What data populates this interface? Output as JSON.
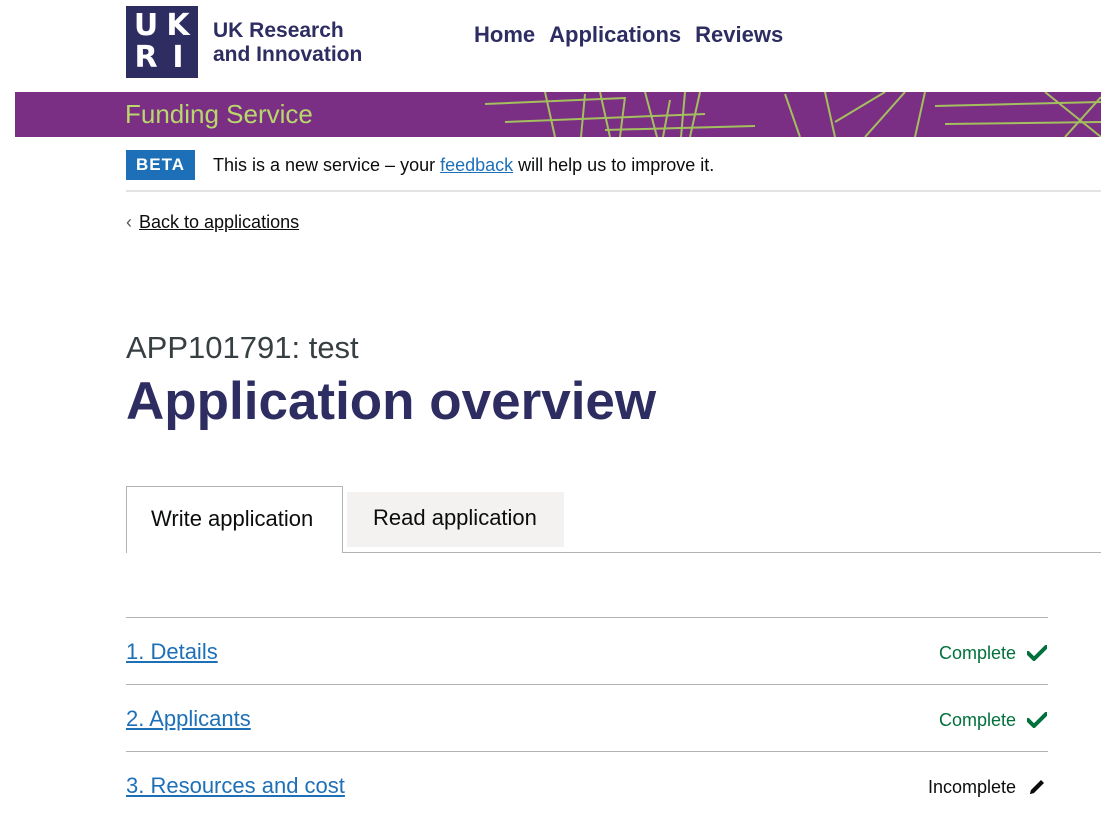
{
  "header": {
    "logo_letters": [
      "U",
      "K",
      "R",
      "I"
    ],
    "org_name_line1": "UK Research",
    "org_name_line2": "and Innovation",
    "nav": [
      {
        "label": "Home"
      },
      {
        "label": "Applications"
      },
      {
        "label": "Reviews"
      }
    ]
  },
  "service_bar": {
    "title": "Funding Service",
    "background_color": "#7a2e84",
    "title_color": "#b9d86b"
  },
  "beta_banner": {
    "tag": "BETA",
    "text_before": "This is a new service – your ",
    "link": "feedback",
    "text_after": " will help us to improve it."
  },
  "back_link": {
    "label": "Back to applications"
  },
  "page": {
    "caption": "APP101791: test",
    "title": "Application overview"
  },
  "tabs": [
    {
      "label": "Write application",
      "selected": true
    },
    {
      "label": "Read application",
      "selected": false
    }
  ],
  "tasks": [
    {
      "label": "1. Details",
      "status": "Complete",
      "icon": "check-icon"
    },
    {
      "label": "2. Applicants",
      "status": "Complete",
      "icon": "check-icon"
    },
    {
      "label": "3. Resources and cost",
      "status": "Incomplete",
      "icon": "pencil-icon"
    }
  ],
  "colors": {
    "brand_navy": "#2e2d62",
    "link_blue": "#1d70b8",
    "complete_green": "#00703c"
  }
}
